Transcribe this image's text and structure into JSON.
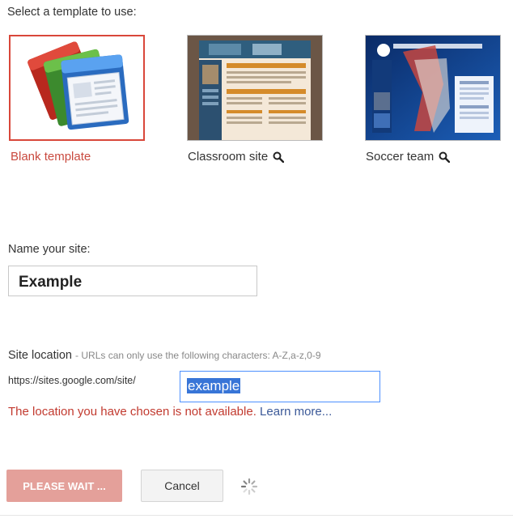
{
  "heading": "Select a template to use:",
  "templates": [
    {
      "label": "Blank template",
      "selected": true,
      "has_preview": false
    },
    {
      "label": "Classroom site",
      "selected": false,
      "has_preview": true,
      "preview_icon": "magnifier-icon"
    },
    {
      "label": "Soccer team",
      "selected": false,
      "has_preview": true,
      "preview_icon": "magnifier-icon"
    }
  ],
  "name": {
    "label": "Name your site:",
    "value": "Example"
  },
  "location": {
    "label": "Site location",
    "hint": "- URLs can only use the following characters: A-Z,a-z,0-9",
    "prefix": "https://sites.google.com/site/",
    "value": "example",
    "error": "The location you have chosen is not available.",
    "error_link": "Learn more..."
  },
  "buttons": {
    "submit": "PLEASE WAIT ...",
    "cancel": "Cancel"
  },
  "colors": {
    "selected_border": "#d9473a",
    "error": "#c23a2f",
    "link": "#3b5998",
    "focus": "#4d90fe",
    "disabled_button": "#e4a09a"
  }
}
